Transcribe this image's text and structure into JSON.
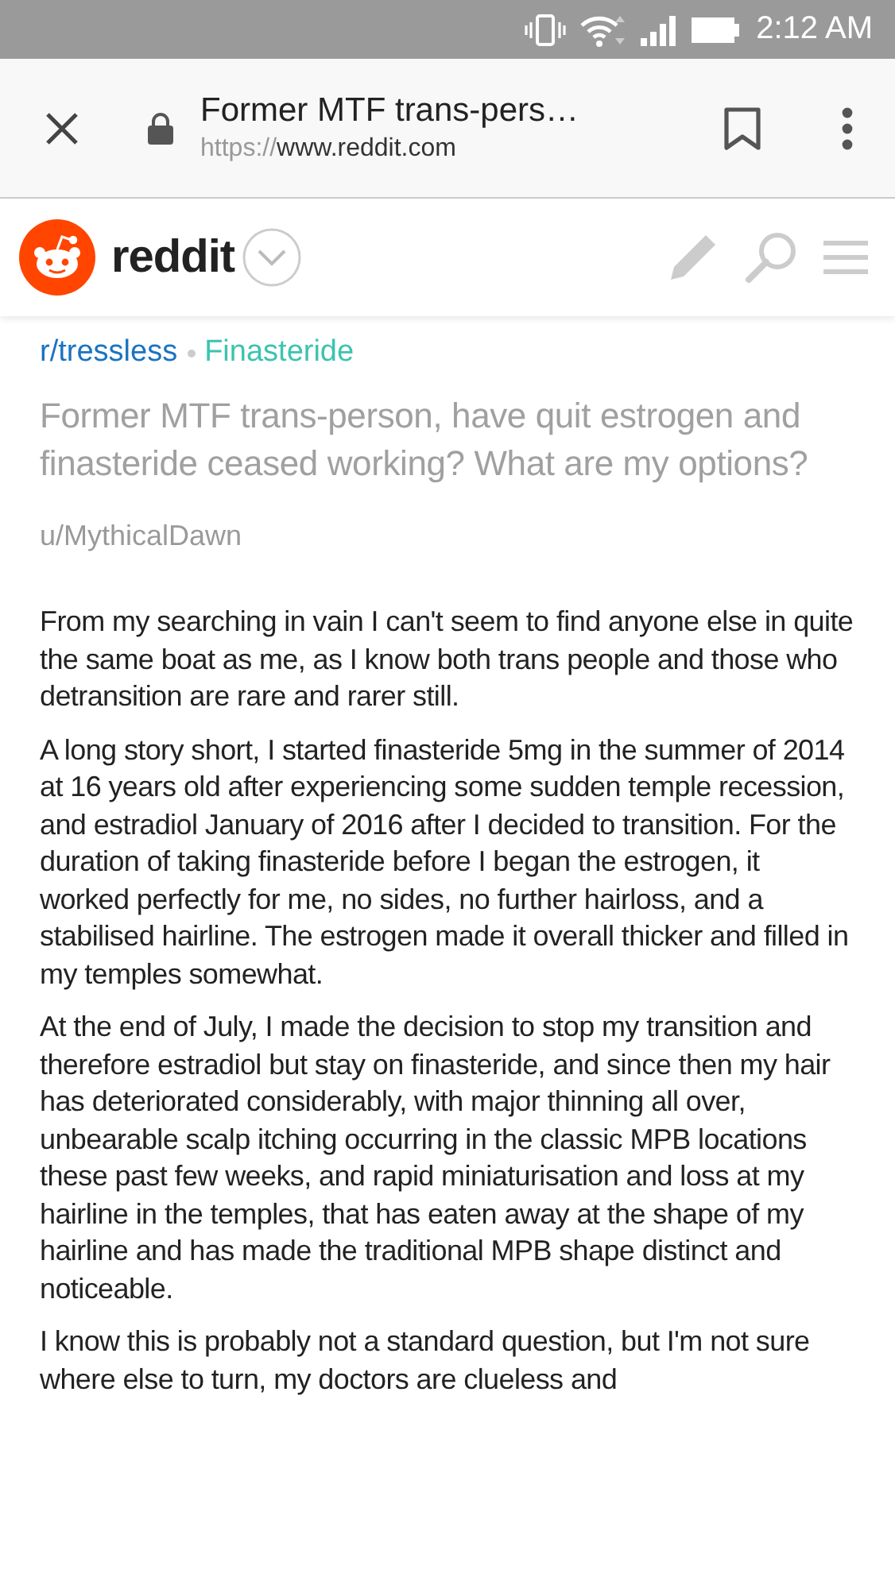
{
  "status_bar": {
    "time": "2:12 AM"
  },
  "browser": {
    "page_title": "Former MTF trans-pers…",
    "url_scheme": "https://",
    "url_host": "www.reddit.com"
  },
  "header": {
    "logo_text": "reddit"
  },
  "post": {
    "subreddit": "r/tressless",
    "flair": "Finasteride",
    "title": "Former MTF trans-person, have quit estrogen and finasteride ceased working? What are my options?",
    "author": "u/MythicalDawn",
    "paragraphs": [
      "From my searching in vain I can't seem to find anyone else in quite the same boat as me, as I know both trans people and those who detransition are rare and rarer still.",
      "A long story short, I started finasteride 5mg in the summer of 2014 at 16 years old after experiencing some sudden temple recession, and estradiol January of 2016 after I decided to transition. For the duration of taking finasteride before I began the estrogen, it worked perfectly for me, no sides, no further hairloss, and a stabilised hairline. The estrogen made it overall thicker and filled in my temples somewhat.",
      "At the end of July, I made the decision to stop my transition and therefore estradiol but stay on finasteride, and since then my hair has deteriorated considerably, with major thinning all over, unbearable scalp itching occurring in the classic MPB locations these past few weeks, and rapid miniaturisation and loss at my hairline in the temples, that has eaten away at the shape of my hairline and has made the traditional MPB shape distinct and noticeable.",
      "I know this is probably not a standard question, but I'm not sure where else to turn, my doctors are clueless and"
    ]
  }
}
